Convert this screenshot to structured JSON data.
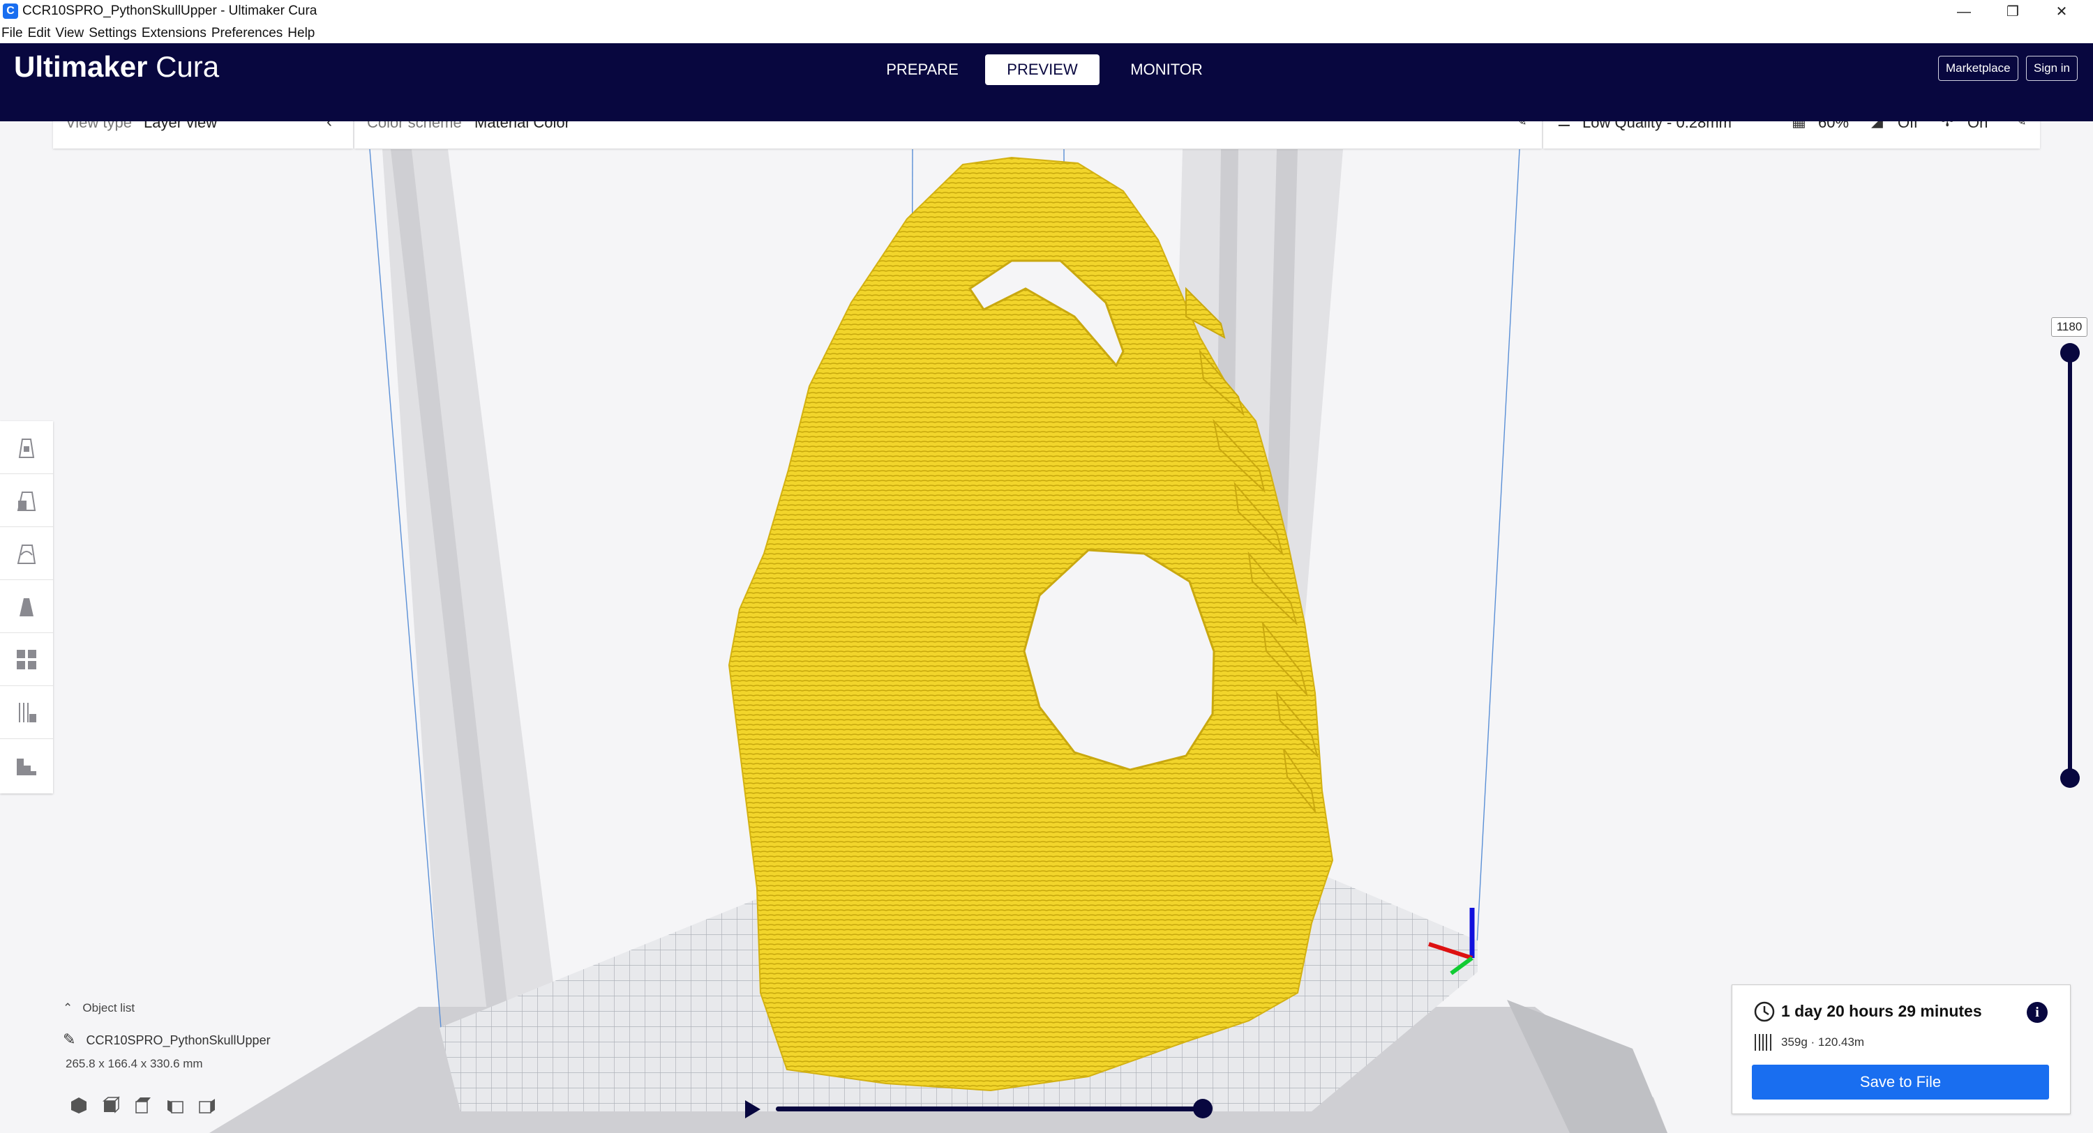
{
  "window": {
    "title": "CCR10SPRO_PythonSkullUpper - Ultimaker Cura",
    "icon_letter": "C",
    "controls": [
      "minimize-icon",
      "restore-icon",
      "close-icon"
    ]
  },
  "menu": [
    "File",
    "Edit",
    "View",
    "Settings",
    "Extensions",
    "Preferences",
    "Help"
  ],
  "header": {
    "brand_bold": "Ultimaker",
    "brand_light": " Cura",
    "stages": [
      "PREPARE",
      "PREVIEW",
      "MONITOR"
    ],
    "active_stage": "PREVIEW",
    "marketplace": "Marketplace",
    "sign_in": "Sign in"
  },
  "view_panel": {
    "label": "View type",
    "value": "Layer view"
  },
  "color_panel": {
    "label": "Color scheme",
    "value": "Material Color"
  },
  "print_settings": {
    "profile": "Low Quality - 0.28mm",
    "infill": "60%",
    "support": "Off",
    "adhesion": "On"
  },
  "layer_slider": {
    "current_layer": "1180"
  },
  "object_list": {
    "toggle_label": "Object list",
    "object_name": "CCR10SPRO_PythonSkullUpper",
    "dimensions": "265.8 x 166.4 x 330.6 mm"
  },
  "playback": {
    "progress": 1.0
  },
  "print_info": {
    "time": "1 day 20 hours 29 minutes",
    "material": "359g · 120.43m",
    "save_label": "Save to File"
  },
  "colors": {
    "header_bg": "#08073f",
    "accent_blue": "#196ef0",
    "model_yellow": "#f2d22a"
  }
}
